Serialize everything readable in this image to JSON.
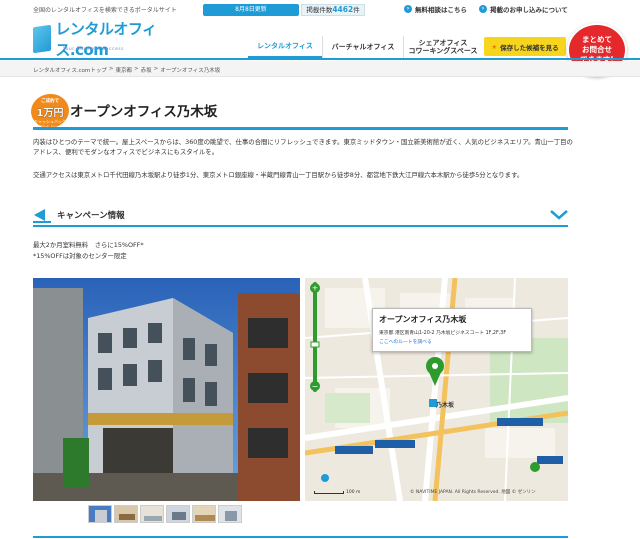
{
  "header": {
    "tagline": "全国のレンタルオフィスを検索できるポータルサイト",
    "update_badge": "8月8日更新",
    "count_label": "掲載件数",
    "count_value": "4462",
    "count_unit": "件",
    "link_consult": "無料相談はこちら",
    "link_apply": "掲載のお申し込みについて",
    "logo_text": "レンタルオフィス.com",
    "logo_sub": "Your Business Success",
    "nav": [
      {
        "label": "レンタルオフィス"
      },
      {
        "label": "バーチャルオフィス"
      },
      {
        "label": "シェアオフィス\nコワーキングスペース"
      }
    ],
    "saved_button": "保存した候補を見る",
    "consult_bubble": "まとめて\nお問合せ\nできます!"
  },
  "breadcrumb": [
    "レンタルオフィス.comトップ",
    ">",
    "東京都",
    ">",
    "赤坂",
    ">",
    "オープンオフィス乃木坂"
  ],
  "badge": {
    "top": "ご成約で",
    "main": "1万円",
    "sub1": "キャッシュバック",
    "sub2": "Click Here"
  },
  "page_title": "オープンオフィス乃木坂",
  "description": {
    "p1": "内装はひとつのテーマで統一。屋上スペースからは、360度の眺望で、仕事の合間にリフレッシュできます。東京ミッドタウン・国立新美術館が近く、人気のビジネスエリア。青山一丁目のアドレス、便利でモダンなオフィスでビジネスにもスタイルを。",
    "p2": "交通アクセスは東京メトロ千代田線乃木坂駅より徒歩1分、東京メトロ銀座線・半蔵門線青山一丁目駅から徒歩8分、都営地下鉄大江戸線六本木駅から徒歩5分となります。"
  },
  "campaign": {
    "title": "キャンペーン情報",
    "line1": "最大2か月室料無料　さらに15%OFF*",
    "line2": "*15%OFFは対象のセンター限定"
  },
  "map": {
    "popup_title": "オープンオフィス乃木坂",
    "popup_addr": "東京都 港区南青山1-20-2 乃木坂ビジネスコート 1F,2F,3F",
    "popup_link": "ここへのルートを調べる",
    "station": "乃木坂",
    "scale": "100 m",
    "copyright": "© NAVITIME JAPAN. All Rights Reserved. 地図 © ゼンリン"
  }
}
